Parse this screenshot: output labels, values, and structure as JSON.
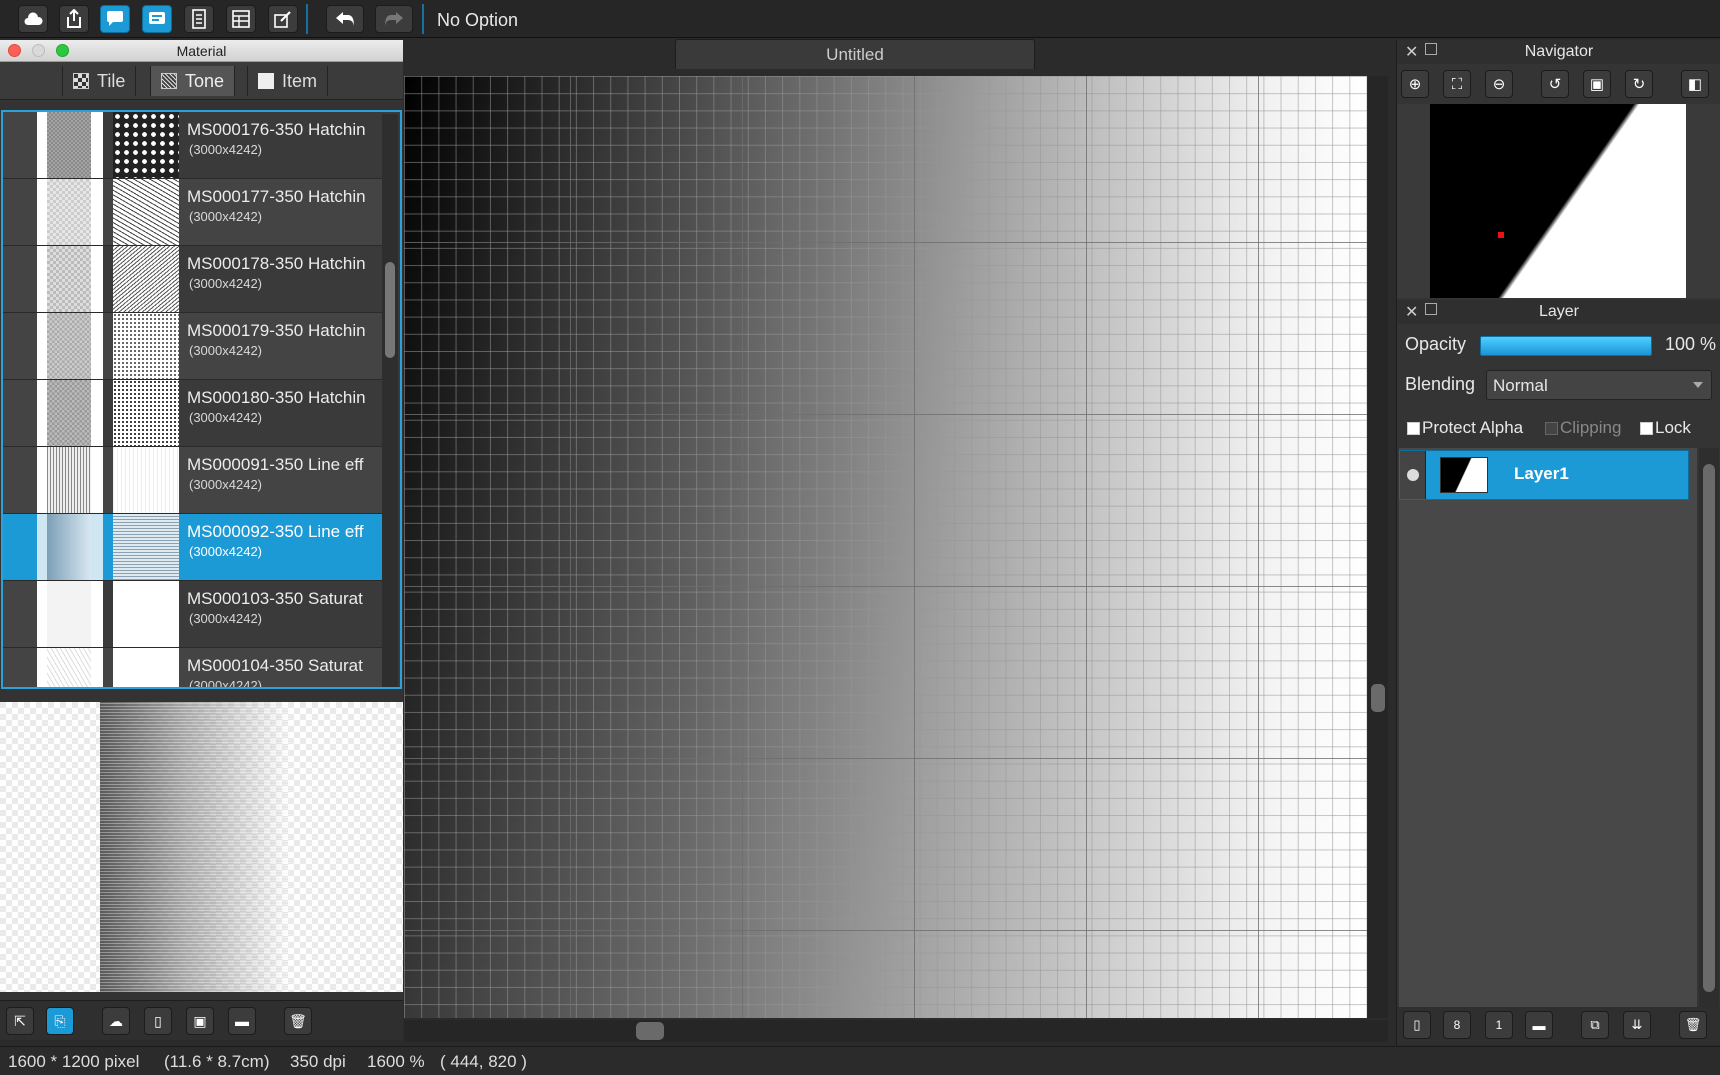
{
  "toolbar": {
    "option_label": "No Option",
    "icons": [
      "cloud-icon",
      "share-icon",
      "chat-icon",
      "notice-icon",
      "document-icon",
      "panel-icon",
      "edit-icon",
      "undo-icon",
      "redo-icon"
    ]
  },
  "material_panel": {
    "title": "Material",
    "tabs": [
      {
        "label": "Tile"
      },
      {
        "label": "Tone"
      },
      {
        "label": "Item"
      }
    ],
    "active_tab": "Tone",
    "items": [
      {
        "name": "MS000176-350 Hatchin",
        "dims": "(3000x4242)"
      },
      {
        "name": "MS000177-350 Hatchin",
        "dims": "(3000x4242)"
      },
      {
        "name": "MS000178-350 Hatchin",
        "dims": "(3000x4242)"
      },
      {
        "name": "MS000179-350 Hatchin",
        "dims": "(3000x4242)"
      },
      {
        "name": "MS000180-350 Hatchin",
        "dims": "(3000x4242)"
      },
      {
        "name": "MS000091-350 Line eff",
        "dims": "(3000x4242)"
      },
      {
        "name": "MS000092-350 Line eff",
        "dims": "(3000x4242)"
      },
      {
        "name": "MS000103-350 Saturat",
        "dims": "(3000x4242)"
      },
      {
        "name": "MS000104-350 Saturat",
        "dims": "(3000x4242)"
      }
    ],
    "selected_index": 6
  },
  "document": {
    "tab_title": "Untitled"
  },
  "navigator": {
    "title": "Navigator"
  },
  "layer_panel": {
    "title": "Layer",
    "opacity_label": "Opacity",
    "opacity_value": "100 %",
    "opacity_fraction": 1.0,
    "blending_label": "Blending",
    "blending_value": "Normal",
    "protect_alpha_label": "Protect Alpha",
    "clipping_label": "Clipping",
    "lock_label": "Lock",
    "layers": [
      {
        "name": "Layer1"
      }
    ]
  },
  "status": {
    "size": "1600 * 1200 pixel",
    "physical": "(11.6 * 8.7cm)",
    "dpi": "350 dpi",
    "zoom": "1600 %",
    "coords": "( 444, 820 )"
  },
  "colors": {
    "accent": "#1c9ad6",
    "selection_border": "#2aa3dc"
  }
}
